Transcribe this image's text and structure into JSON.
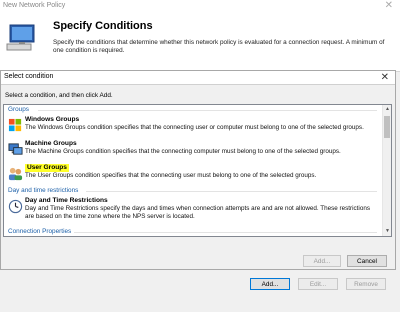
{
  "wizard": {
    "title": "New Network Policy",
    "close_glyph": "✕",
    "heading": "Specify Conditions",
    "description": "Specify the conditions that determine whether this network policy is evaluated for a connection request. A minimum of one condition is required."
  },
  "dialog": {
    "title": "Select condition",
    "close_glyph": "✕",
    "instruction": "Select a condition, and then click Add.",
    "groups": [
      {
        "label": "Groups",
        "items": [
          {
            "name": "Windows Groups",
            "description": "The Windows Groups condition specifies that the connecting user or computer must belong to one of the selected groups.",
            "icon": "windows-groups-icon"
          },
          {
            "name": "Machine Groups",
            "description": "The Machine Groups condition specifies that the connecting computer must belong to one of the selected groups.",
            "icon": "machine-groups-icon"
          },
          {
            "name": "User Groups",
            "description": "The User Groups condition specifies that the connecting user must belong to one of the selected groups.",
            "icon": "user-groups-icon",
            "highlighted": true
          }
        ]
      },
      {
        "label": "Day and time restrictions",
        "items": [
          {
            "name": "Day and Time Restrictions",
            "description": "Day and Time Restrictions specify the days and times when connection attempts are and are not allowed. These restrictions are based on the time zone where the NPS server is located.",
            "icon": "clock-icon"
          }
        ]
      },
      {
        "label": "Connection Properties",
        "items": []
      }
    ],
    "add_label": "Add...",
    "cancel_label": "Cancel"
  },
  "footer": {
    "add_label": "Add...",
    "edit_label": "Edit...",
    "remove_label": "Remove"
  },
  "colors": {
    "highlight": "#ffff2a",
    "group_header": "#1b5fa8",
    "accent": "#0078d7"
  }
}
